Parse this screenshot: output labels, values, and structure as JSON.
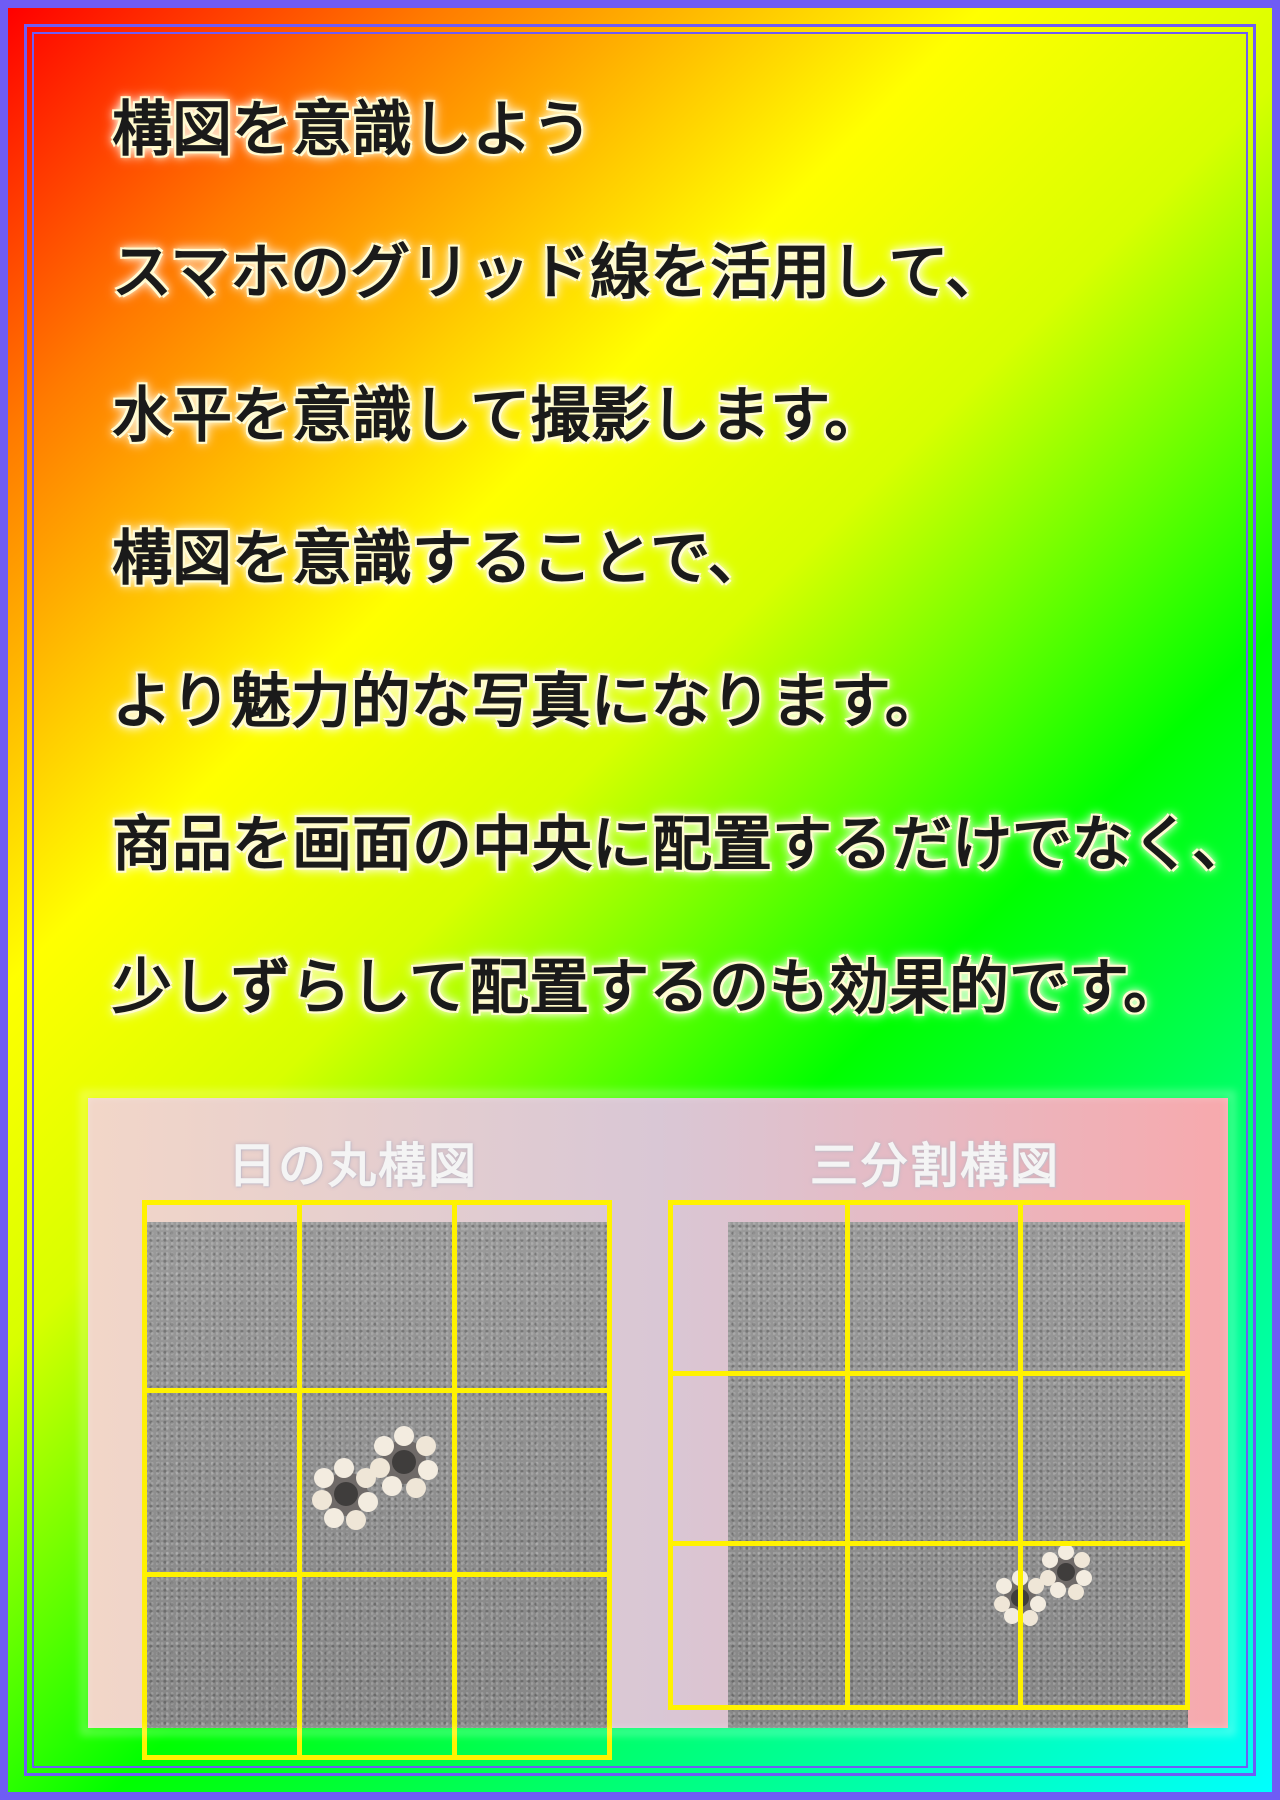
{
  "heading": "構図を意識しよう",
  "body_lines": [
    "スマホのグリッド線を活用して、",
    "水平を意識して撮影します。",
    "構図を意識することで、",
    "より魅力的な写真になります。",
    "商品を画面の中央に配置するだけでなく、",
    "少しずらして配置するのも効果的です。"
  ],
  "examples": {
    "left_caption": "日の丸構図",
    "right_caption": "三分割構図"
  },
  "colors": {
    "grid_line": "#fff200",
    "frame": "#6f5cf5"
  },
  "icons": {
    "product": "pearl-flower-earring-icon"
  }
}
